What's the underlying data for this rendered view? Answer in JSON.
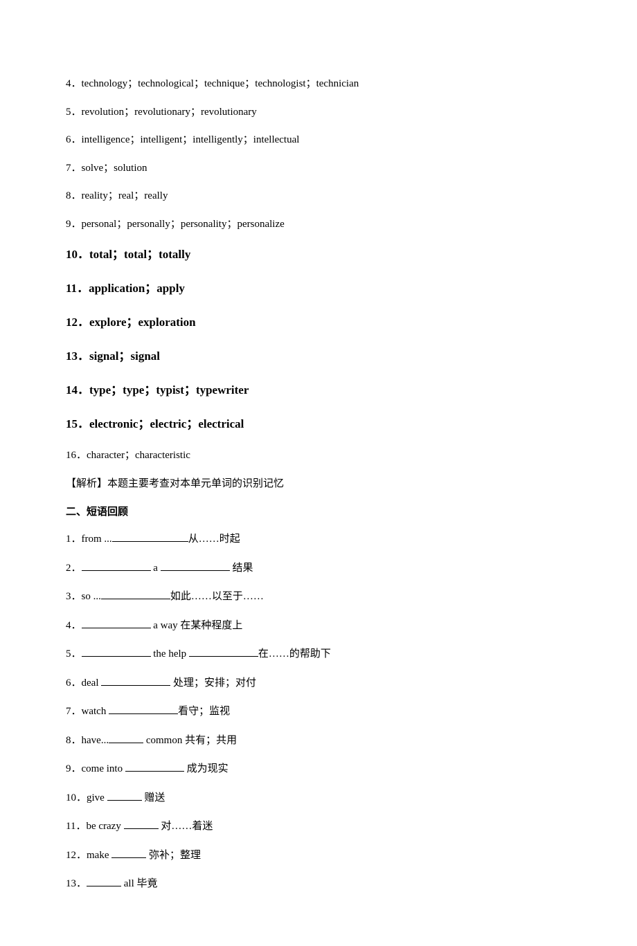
{
  "normal_items": [
    {
      "num": "4",
      "text": "technology；technological；technique；technologist；technician"
    },
    {
      "num": "5",
      "text": "revolution；revolutionary；revolutionary"
    },
    {
      "num": "6",
      "text": "intelligence；intelligent；intelligently；intellectual"
    },
    {
      "num": "7",
      "text": "solve；solution"
    },
    {
      "num": "8",
      "text": "reality；real；really"
    },
    {
      "num": "9",
      "text": "personal；personally；personality；personalize"
    }
  ],
  "bold_items": [
    {
      "num": "10",
      "text": "total；total；totally"
    },
    {
      "num": "11",
      "text": "application；apply"
    },
    {
      "num": "12",
      "text": "explore；exploration"
    },
    {
      "num": "13",
      "text": "signal；signal"
    },
    {
      "num": "14",
      "text": "type；type；typist；typewriter"
    },
    {
      "num": "15",
      "text": "electronic；electric；electrical"
    }
  ],
  "item16": {
    "num": "16",
    "text": "character；characteristic"
  },
  "analysis": "【解析】本题主要考查对本单元单词的识别记忆",
  "section2_heading": "二、短语回顾",
  "phrases": {
    "p1": {
      "num": "1",
      "pre": "from ...",
      "post": "从……时起"
    },
    "p2": {
      "num": "2",
      "mid": " a ",
      "post": " 结果"
    },
    "p3": {
      "num": "3",
      "pre": "so ...",
      "post": "如此……以至于……"
    },
    "p4": {
      "num": "4",
      "post": " a way 在某种程度上"
    },
    "p5": {
      "num": "5",
      "mid": " the help ",
      "post": "在……的帮助下"
    },
    "p6": {
      "num": "6",
      "pre": "deal ",
      "post": " 处理；安排；对付"
    },
    "p7": {
      "num": "7",
      "pre": "watch ",
      "post": "看守；监视"
    },
    "p8": {
      "num": "8",
      "pre": "have...",
      "post": " common      共有；共用"
    },
    "p9": {
      "num": "9",
      "pre": "come into ",
      "post": "  成为现实"
    },
    "p10": {
      "num": "10",
      "pre": "give ",
      "post": "  赠送"
    },
    "p11": {
      "num": "11",
      "pre": "be crazy ",
      "post": "  对……着迷"
    },
    "p12": {
      "num": "12",
      "pre": "make ",
      "post": "  弥补；整理"
    },
    "p13": {
      "num": "13",
      "post": " all  毕竟"
    }
  }
}
